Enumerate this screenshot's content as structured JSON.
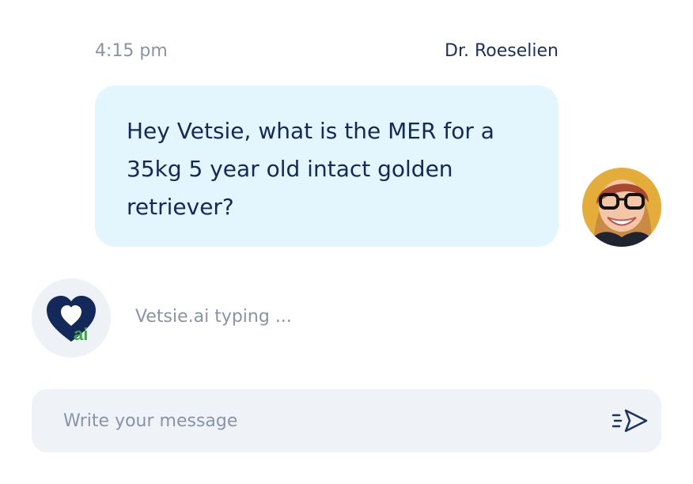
{
  "message": {
    "time": "4:15 pm",
    "sender": "Dr. Roeselien",
    "text": "Hey Vetsie, what is the MER for a 35kg 5 year old intact golden retriever?"
  },
  "assistant": {
    "typing_text": "Vetsie.ai typing ...",
    "logo_text": "ai"
  },
  "composer": {
    "placeholder": "Write your message"
  },
  "icons": {
    "send": "send-paper-plane-icon",
    "user_avatar": "user-avatar-photo",
    "bot_avatar": "vetsie-heart-logo"
  },
  "colors": {
    "bubble_bg": "#e3f5fd",
    "text_dark": "#12295a",
    "muted": "#8a93a6",
    "composer_bg": "#eff3f7",
    "logo_navy": "#12295a",
    "logo_green": "#3ca745"
  }
}
